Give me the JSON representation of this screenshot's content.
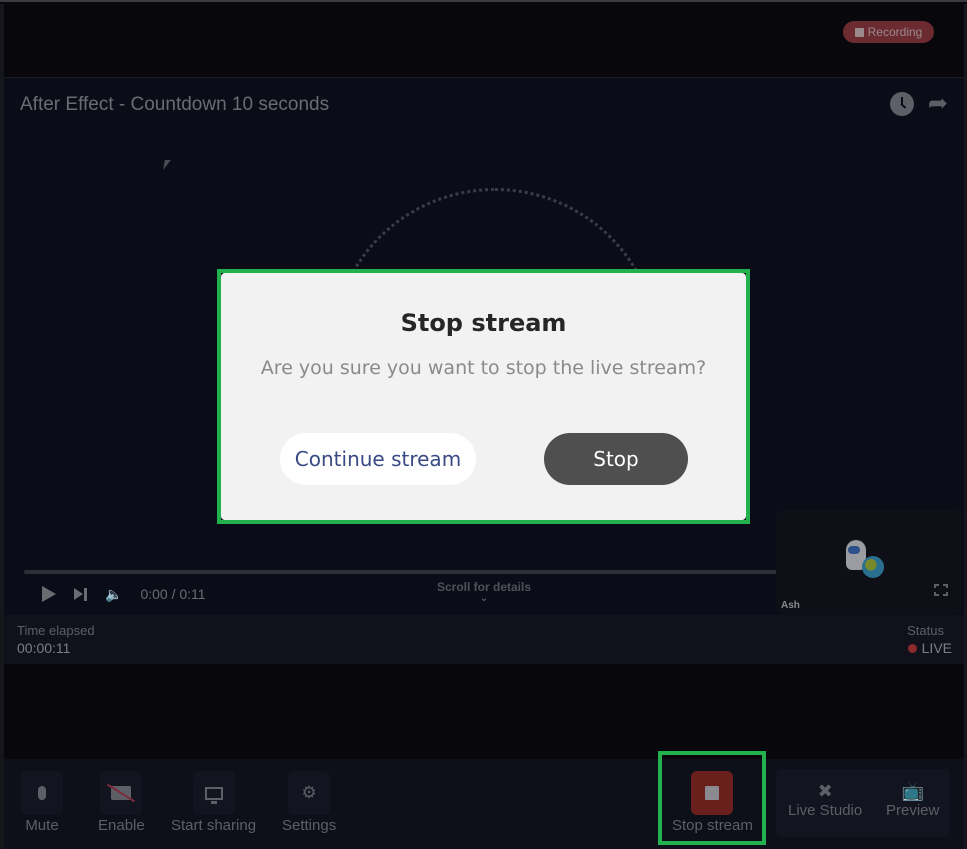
{
  "header": {
    "recording_badge": "Recording"
  },
  "video": {
    "title": "After Effect - Countdown 10 seconds",
    "time_display": "0:00 / 0:11",
    "scroll_hint": "Scroll for details",
    "pip_name": "Ash",
    "icons": {
      "clock": "clock-icon",
      "share": "share-icon",
      "play": "play-icon",
      "next": "next-icon",
      "volume": "volume-icon",
      "fullscreen": "fullscreen-icon"
    }
  },
  "status_bar": {
    "elapsed_label": "Time elapsed",
    "elapsed_value": "00:00:11",
    "status_label": "Status",
    "status_value": "LIVE",
    "status_color": "#8a2a2a"
  },
  "toolbar": {
    "mute_label": "Mute",
    "enable_label": "Enable",
    "share_label": "Start sharing",
    "settings_label": "Settings",
    "stop_stream_label": "Stop stream",
    "live_studio_label": "Live Studio",
    "preview_label": "Preview"
  },
  "modal": {
    "title": "Stop stream",
    "message": "Are you sure you want to stop the live stream?",
    "continue_label": "Continue stream",
    "stop_label": "Stop"
  },
  "colors": {
    "highlight": "#22b14c",
    "stop_button": "#4f4f4f",
    "continue_text": "#3a4a84",
    "recording": "#6b2b30"
  }
}
